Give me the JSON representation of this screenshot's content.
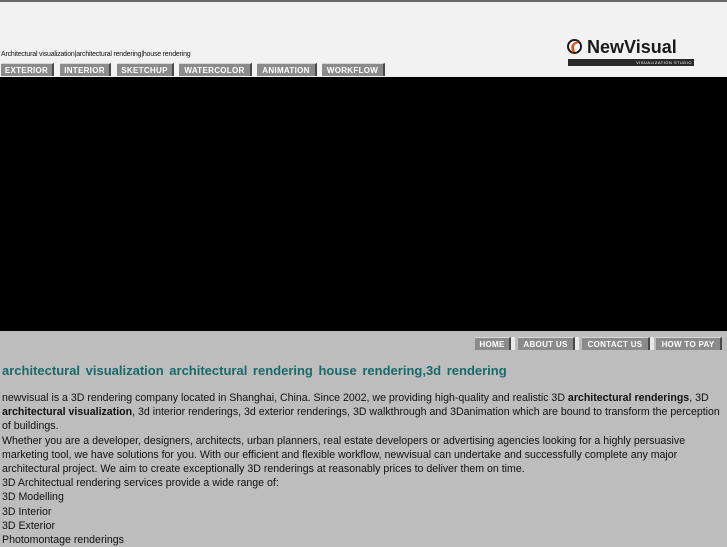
{
  "header": {
    "tagline": "Architectural visualization|architectural rendering|house rendering",
    "logo": {
      "name": "NewVisual",
      "subtitle": "VISUALIZATION STUDIO",
      "accent_color": "#e0541f"
    }
  },
  "top_nav": {
    "items": [
      {
        "label": "EXTERIOR"
      },
      {
        "label": "INTERIOR"
      },
      {
        "label": "SKETCHUP"
      },
      {
        "label": "WATERCOLOR"
      },
      {
        "label": "ANIMATION"
      },
      {
        "label": "WORKFLOW"
      }
    ]
  },
  "bottom_nav": {
    "items": [
      {
        "label": "HOME"
      },
      {
        "label": "ABOUT US"
      },
      {
        "label": "CONTACT US"
      },
      {
        "label": "HOW TO PAY"
      }
    ]
  },
  "main": {
    "heading": "architectural visualization  architectural rendering  house rendering,3d rendering",
    "intro": {
      "t1": "newvisual is a 3D rendering company located in Shanghai, China. Since 2002, we providing high-quality and realistic 3D ",
      "b1": "architectural renderings",
      "t2": ", 3D ",
      "b2": "architectural visualization",
      "t3": ", 3d interior renderings, 3d exterior renderings, 3D walkthrough and 3Danimation which are bound to transform the perception of buildings."
    },
    "paragraph2": "Whether you are a developer, designers, architects, urban planners, real estate developers or advertising agencies looking for a highly persuasive marketing tool, we have solutions for you. With our efficient and flexible workflow, newvisual can undertake and successfully complete any major architectural project. We aim to create exceptionally 3D renderings at reasonably prices to deliver them on time.",
    "services_intro": "3D Architectual rendering services provide a wide range of:",
    "services": [
      "3D Modelling",
      "3D Interior",
      "3D Exterior",
      "Photomontage renderings"
    ]
  },
  "colors": {
    "header_bg": "#f2f2f2",
    "nav_btn": "#8b8b8b",
    "heading": "#1a6a6a",
    "page_bg": "#bdbdbd"
  }
}
